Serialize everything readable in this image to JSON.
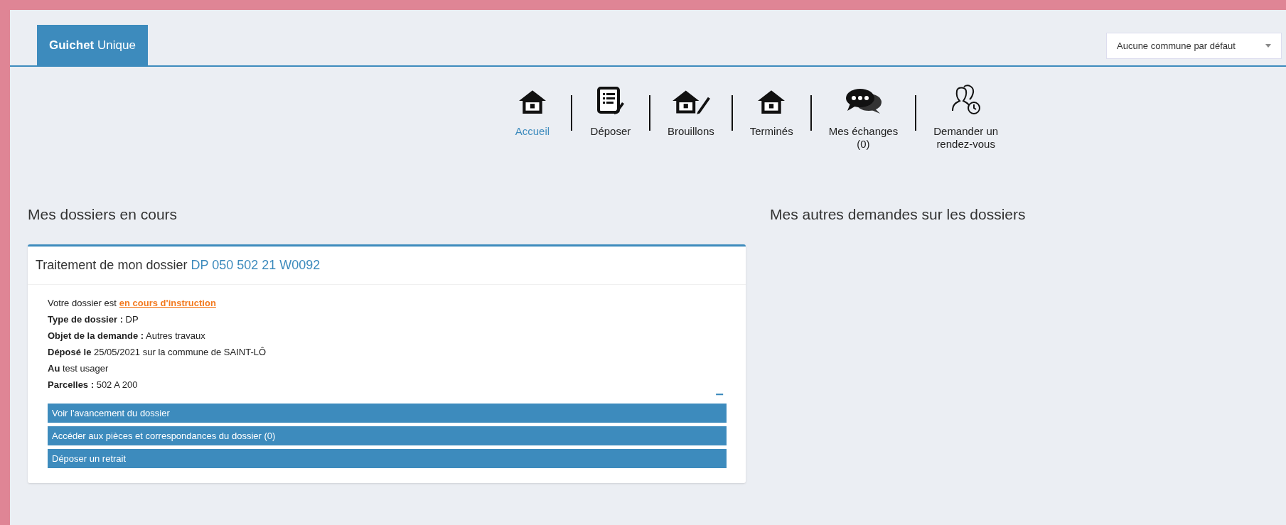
{
  "tab": {
    "label": "**Guichet** Unique",
    "selected": true
  },
  "commune_select": {
    "value": "Aucune commune par défaut"
  },
  "nav": [
    {
      "label": "Accueil",
      "selected": true
    },
    {
      "label": "Déposer",
      "selected": false
    },
    {
      "label": "Brouillons",
      "selected": false
    },
    {
      "label": "Terminés",
      "selected": false
    },
    {
      "label": "Mes échanges\n(0)",
      "selected": false
    },
    {
      "label": "Demander un\nrendez-vous",
      "selected": false
    }
  ],
  "left_section": {
    "title": "Mes dossiers en cours",
    "card": {
      "title": "Traitement de mon dossier",
      "reference": "DP 050 502 21 W0092",
      "status_prefix": "Votre dossier est",
      "status_link": "en cours d'instruction",
      "details": [
        "**Type de dossier :** DP",
        "**Objet de la demande :** Autres travaux",
        "**Déposé le** 25/05/2021 sur la commune de SAINT-LÔ",
        "**Au** test usager",
        "**Parcelles :** 502 A 200"
      ],
      "collapse": "−",
      "actions": [
        "Voir l'avancement du dossier",
        "Accéder aux pièces et correspondances du dossier (0)",
        "Déposer un retrait"
      ]
    }
  },
  "right_section": {
    "title": "Mes autres demandes sur les dossiers"
  }
}
